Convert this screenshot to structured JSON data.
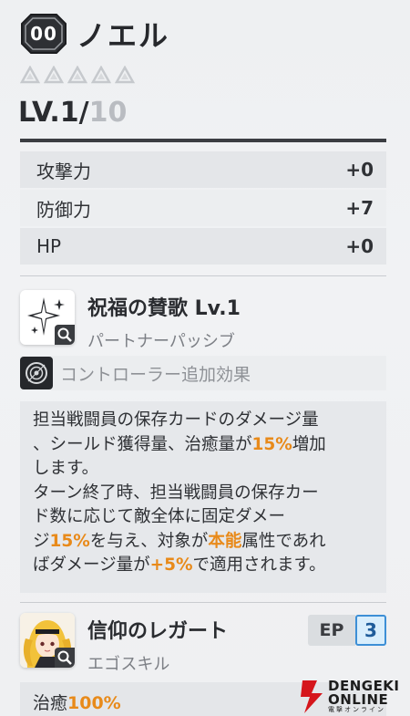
{
  "header": {
    "rank": "00",
    "name": "ノエル"
  },
  "stars": {
    "total": 5,
    "filled": 0
  },
  "level": {
    "current": "LV.1/",
    "max": "10"
  },
  "stats": [
    {
      "label": "攻撃力",
      "value": "+0"
    },
    {
      "label": "防御力",
      "value": "+7"
    },
    {
      "label": "HP",
      "value": "+0"
    }
  ],
  "skill1": {
    "title": "祝福の賛歌 Lv.1",
    "subtitle": "パートナーパッシブ",
    "icon": "sparkle-icon"
  },
  "controller": {
    "label": "コントローラー追加効果",
    "icon": "controller-icon"
  },
  "description": {
    "p1a": "担当戦闘員の保存カードのダメージ量\n、シールド獲得量、治癒量が",
    "p1b": "15%",
    "p1c": "増加\nします。\nターン終了時、担当戦闘員の保存カー\nド数に応じて敵全体に固定ダメー\nジ",
    "p2a": "15%",
    "p2b": "を与え、対象が",
    "p2c": "本能",
    "p2d": "属性であれ\nばダメージ量が",
    "p2e": "+5%",
    "p2f": "で適用されます。"
  },
  "skill2": {
    "title": "信仰のレガート",
    "subtitle": "エゴスキル",
    "icon": "character-portrait-icon"
  },
  "ep": {
    "label": "EP",
    "value": "3"
  },
  "heal": {
    "label": "治癒",
    "value": "100%"
  },
  "watermark": {
    "line1": "DENGEKI",
    "line2": "ONLINE",
    "line3": "電撃オンライン"
  },
  "colors": {
    "highlight": "#e88a1a",
    "ep_accent": "#3d8fd6",
    "dark": "#3b3d42"
  }
}
